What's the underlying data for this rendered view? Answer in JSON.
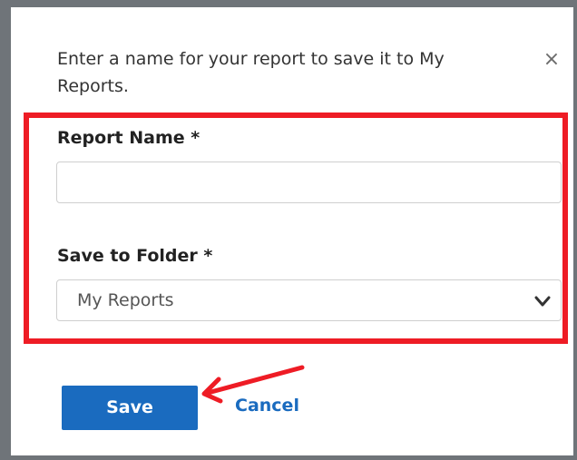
{
  "dialog": {
    "intro": "Enter a name for your report to save it to My Reports.",
    "close_icon": "×"
  },
  "form": {
    "report_name_label": "Report Name *",
    "report_name_value": "",
    "report_name_placeholder": "",
    "folder_label": "Save to Folder *",
    "folder_selected": "My Reports"
  },
  "actions": {
    "save_label": "Save",
    "cancel_label": "Cancel"
  },
  "icons": {
    "close": "close-icon",
    "dropdown": "chevron-down-icon",
    "annotation_arrow": "arrow-icon"
  },
  "colors": {
    "highlight": "#ee1c25",
    "primary": "#1a6bbf",
    "frame": "#6f7479"
  }
}
